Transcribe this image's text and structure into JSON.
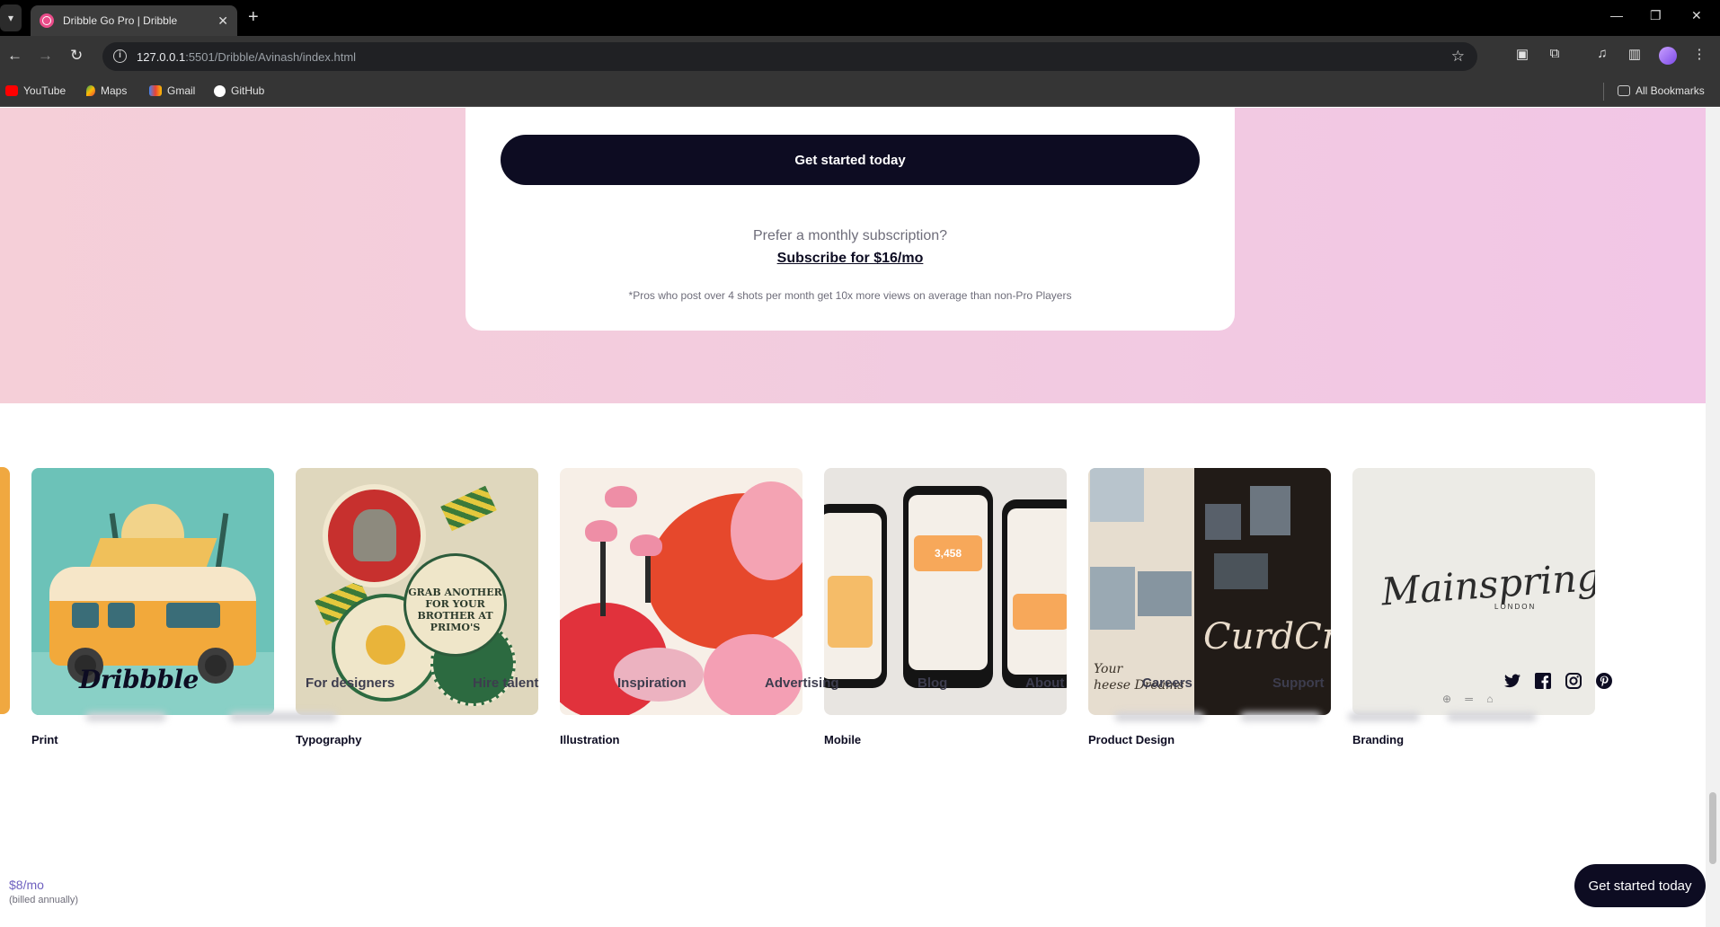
{
  "browser": {
    "tab_title": "Dribble Go Pro | Dribble",
    "url_host": "127.0.0.1",
    "url_path": ":5501/Dribble/Avinash/index.html",
    "bookmarks": [
      "YouTube",
      "Maps",
      "Gmail",
      "GitHub"
    ],
    "all_bookmarks": "All Bookmarks"
  },
  "pricing": {
    "cta_label": "Get started today",
    "prefer_text": "Prefer a monthly subscription?",
    "subscribe_link": "Subscribe for $16/mo",
    "footnote": "*Pros who post over 4 shots per month get 10x more views on average than non-Pro Players"
  },
  "categories": [
    {
      "label": "Print"
    },
    {
      "label": "Typography"
    },
    {
      "label": "Illustration"
    },
    {
      "label": "Mobile"
    },
    {
      "label": "Product Design"
    },
    {
      "label": "Branding"
    }
  ],
  "thumb_text": {
    "typo_badge": "GRAB ANOTHER FOR YOUR BROTHER AT PRIMO'S",
    "mobile_value": "3,458",
    "product_big": "CurdCre",
    "product_serif": "Your\nheese Dreams",
    "brand_logo": "Mainspring",
    "brand_sub": "LONDON"
  },
  "footer": {
    "logo": "Dribbble",
    "nav": [
      "For designers",
      "Hire talent",
      "Inspiration",
      "Advertising",
      "Blog",
      "About",
      "Careers",
      "Support"
    ],
    "social_icons": [
      "twitter-icon",
      "facebook-icon",
      "instagram-icon",
      "pinterest-icon"
    ]
  },
  "sticky_bar": {
    "price": "$8/mo",
    "billed": "(billed annually)",
    "cta_label": "Get started today"
  },
  "colors": {
    "brand_dark": "#0d0c22",
    "accent_price": "#6f61c0",
    "band_pink": "#f5cfd8"
  }
}
